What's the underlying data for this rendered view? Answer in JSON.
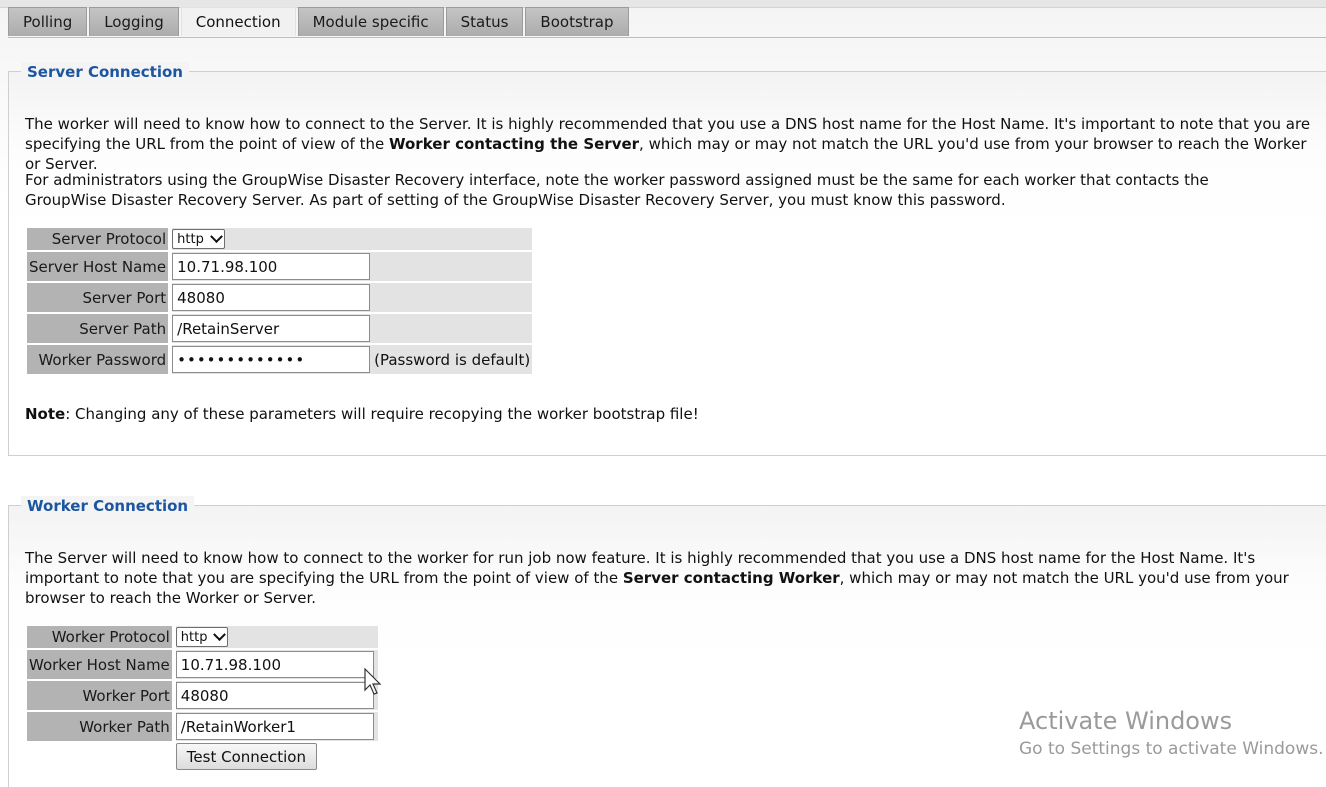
{
  "tabs": [
    {
      "label": "Polling",
      "active": false
    },
    {
      "label": "Logging",
      "active": false
    },
    {
      "label": "Connection",
      "active": true
    },
    {
      "label": "Module specific",
      "active": false
    },
    {
      "label": "Status",
      "active": false
    },
    {
      "label": "Bootstrap",
      "active": false
    }
  ],
  "server_connection": {
    "title": "Server Connection",
    "para1_before": "The worker will need to know how to connect to the Server. It is highly recommended that you use a DNS host name for the Host Name. It's important to note that you are specifying the URL from the point of view of the ",
    "para1_bold": "Worker contacting the Server",
    "para1_after": ", which may or may not match the URL you'd use from your browser to reach the Worker or Server.",
    "para2": "For administrators using the GroupWise Disaster Recovery interface, note the worker password assigned must be the same for each worker that contacts the GroupWise Disaster Recovery Server. As part of setting of the GroupWise Disaster Recovery Server, you must know this password.",
    "protocol_label": "Server Protocol",
    "protocol_value": "http",
    "host_label": "Server Host Name",
    "host_value": "10.71.98.100",
    "port_label": "Server Port",
    "port_value": "48080",
    "path_label": "Server Path",
    "path_value": "/RetainServer",
    "password_label": "Worker Password",
    "password_value": "•••••••••••••",
    "password_hint": "(Password is default)",
    "note_bold": "Note",
    "note_text": ": Changing any of these parameters will require recopying the worker bootstrap file!"
  },
  "worker_connection": {
    "title": "Worker Connection",
    "para1_before": "The Server will need to know how to connect to the worker for run job now feature. It is highly recommended that you use a DNS host name for the Host Name. It's important to note that you are specifying the URL from the point of view of the ",
    "para1_bold": "Server contacting Worker",
    "para1_after": ", which may or may not match the URL you'd use from your browser to reach the Worker or Server.",
    "protocol_label": "Worker Protocol",
    "protocol_value": "http",
    "host_label": "Worker Host Name",
    "host_value": "10.71.98.100",
    "port_label": "Worker Port",
    "port_value": "48080",
    "path_label": "Worker Path",
    "path_value": "/RetainWorker1",
    "test_button": "Test Connection"
  },
  "watermark": {
    "title": "Activate Windows",
    "subtitle": "Go to Settings to activate Windows."
  }
}
